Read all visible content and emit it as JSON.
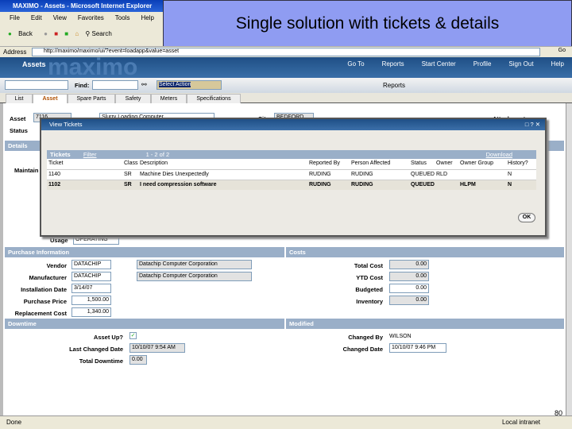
{
  "browser": {
    "title": "MAXIMO - Assets - Microsoft Internet Explorer",
    "menu": [
      "File",
      "Edit",
      "View",
      "Favorites",
      "Tools",
      "Help"
    ],
    "back": "Back",
    "search": "Search",
    "address_label": "Address",
    "address": "http://maximo/maximo/ui/?event=loadapp&value=asset",
    "go": "Go",
    "status": "Done",
    "zone": "Local intranet"
  },
  "slide": {
    "title": "Single solution with tickets & details",
    "page": "80"
  },
  "maximo": {
    "app": "Assets",
    "logo": "maximo",
    "links": [
      "Go To",
      "Reports",
      "Start Center",
      "Profile",
      "Sign Out",
      "Help"
    ],
    "find_label": "Find:",
    "action": "Select Action",
    "reports": "Reports",
    "tabs": [
      "List",
      "Asset",
      "Spare Parts",
      "Safety",
      "Meters",
      "Specifications"
    ]
  },
  "asset": {
    "asset_label": "Asset",
    "asset": "7116",
    "desc": "Slurry Loading Computer",
    "site_label": "Site",
    "site": "BEDFORD",
    "status_label": "Status",
    "attachments": "Attachments",
    "details": "Details",
    "maintain": "Maintain",
    "usage_label": "Usage",
    "usage": "OPERATING"
  },
  "dialog": {
    "title": "View Tickets",
    "tickets": "Tickets",
    "filter": "Filter",
    "paging": "1 - 2 of 2",
    "download": "Download",
    "ok": "OK",
    "columns": [
      "Ticket",
      "Class",
      "Description",
      "Reported By",
      "Person Affected",
      "Status",
      "Owner",
      "Owner Group",
      "History?"
    ],
    "rows": [
      [
        "1140",
        "SR",
        "Machine Dies Unexpectedly",
        "RUDING",
        "RUDING",
        "QUEUED",
        "RLD",
        "",
        "N"
      ],
      [
        "1102",
        "SR",
        "I need compression software",
        "RUDING",
        "RUDING",
        "QUEUED",
        "",
        "HLPM",
        "N"
      ]
    ]
  },
  "purchase": {
    "title": "Purchase Information",
    "vendor_label": "Vendor",
    "vendor": "DATACHIP",
    "vendor_name": "Datachip Computer Corporation",
    "manufacturer_label": "Manufacturer",
    "manufacturer": "DATACHIP",
    "manufacturer_name": "Datachip Computer Corporation",
    "install_label": "Installation Date",
    "install": "3/14/07",
    "price_label": "Purchase Price",
    "price": "1,500.00",
    "replace_label": "Replacement Cost",
    "replace": "1,340.00"
  },
  "costs": {
    "title": "Costs",
    "total_label": "Total Cost",
    "total": "0.00",
    "ytd_label": "YTD Cost",
    "ytd": "0.00",
    "budget_label": "Budgeted",
    "budget": "0.00",
    "inv_label": "Inventory",
    "inv": "0.00"
  },
  "downtime": {
    "title": "Downtime",
    "up_label": "Asset Up?",
    "last_label": "Last Changed Date",
    "last": "10/10/07 9:54 AM",
    "total_label": "Total Downtime",
    "total": "0.00"
  },
  "modified": {
    "title": "Modified",
    "by_label": "Changed By",
    "by": "WILSON",
    "date_label": "Changed Date",
    "date": "10/10/07 9:46 PM"
  }
}
